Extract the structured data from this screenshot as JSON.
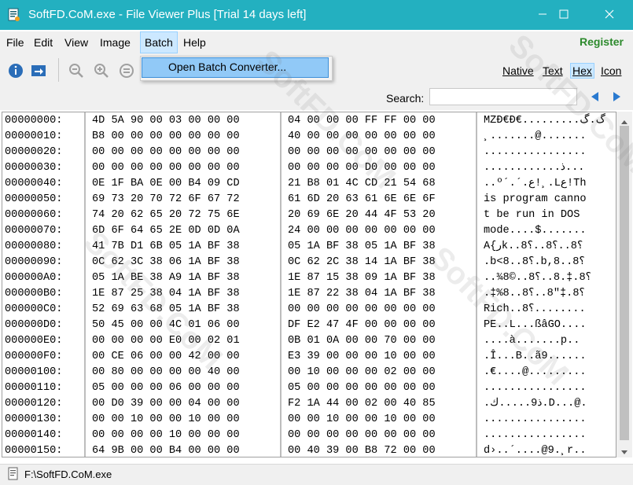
{
  "window": {
    "title": "SoftFD.CoM.exe - File Viewer Plus [Trial 14 days left]"
  },
  "menu": {
    "items": [
      "File",
      "Edit",
      "View",
      "Image",
      "Batch",
      "Help"
    ],
    "register": "Register"
  },
  "batch_menu": {
    "items": [
      "Open Batch Converter..."
    ]
  },
  "viewmodes": [
    "Native",
    "Text",
    "Hex",
    "Icon"
  ],
  "search": {
    "label": "Search:",
    "value": ""
  },
  "hex": {
    "rows": [
      {
        "addr": "00000000:",
        "h1": "4D 5A 90 00 03 00 00 00",
        "h2": "04 00 00 00 FF FF 00 00",
        "ascii": "MZÐ€Ð€.........گ.گ"
      },
      {
        "addr": "00000010:",
        "h1": "B8 00 00 00 00 00 00 00",
        "h2": "40 00 00 00 00 00 00 00",
        "ascii": "¸.......@......."
      },
      {
        "addr": "00000020:",
        "h1": "00 00 00 00 00 00 00 00",
        "h2": "00 00 00 00 00 00 00 00",
        "ascii": "................"
      },
      {
        "addr": "00000030:",
        "h1": "00 00 00 00 00 00 00 00",
        "h2": "00 00 00 00 D0 00 00 00",
        "ascii": "............ذ..."
      },
      {
        "addr": "00000040:",
        "h1": "0E 1F BA 0E 00 B4 09 CD",
        "h2": "21 B8 01 4C CD 21 54 68",
        "ascii": "..º´.´.ع!¸.Lع!Th"
      },
      {
        "addr": "00000050:",
        "h1": "69 73 20 70 72 6F 67 72",
        "h2": "61 6D 20 63 61 6E 6E 6F",
        "ascii": "is program canno"
      },
      {
        "addr": "00000060:",
        "h1": "74 20 62 65 20 72 75 6E",
        "h2": "20 69 6E 20 44 4F 53 20",
        "ascii": "t be run in DOS "
      },
      {
        "addr": "00000070:",
        "h1": "6D 6F 64 65 2E 0D 0D 0A",
        "h2": "24 00 00 00 00 00 00 00",
        "ascii": "mode....$......."
      },
      {
        "addr": "00000080:",
        "h1": "41 7B D1 6B 05 1A BF 38",
        "h2": "05 1A BF 38 05 1A BF 38",
        "ascii": "A{رk..؟8..؟8..؟8"
      },
      {
        "addr": "00000090:",
        "h1": "0C 62 3C 38 06 1A BF 38",
        "h2": "0C 62 2C 38 14 1A BF 38",
        "ascii": ".b<8..؟8.b,8..؟8"
      },
      {
        "addr": "000000A0:",
        "h1": "05 1A BE 38 A9 1A BF 38",
        "h2": "1E 87 15 38 09 1A BF 38",
        "ascii": "..¾8©..؟8.‡.8..؟8"
      },
      {
        "addr": "000000B0:",
        "h1": "1E 87 25 38 04 1A BF 38",
        "h2": "1E 87 22 38 04 1A BF 38",
        "ascii": ".‡%8..؟8.‡\"8..؟8"
      },
      {
        "addr": "000000C0:",
        "h1": "52 69 63 68 05 1A BF 38",
        "h2": "00 00 00 00 00 00 00 00",
        "ascii": "Rich..؟8........"
      },
      {
        "addr": "000000D0:",
        "h1": "50 45 00 00 4C 01 06 00",
        "h2": "DF E2 47 4F 00 00 00 00",
        "ascii": "PE..L...ßâGO...."
      },
      {
        "addr": "000000E0:",
        "h1": "00 00 00 00 E0 00 02 01",
        "h2": "0B 01 0A 00 00 70 00 00",
        "ascii": "....à.......p.."
      },
      {
        "addr": "000000F0:",
        "h1": "00 CE 06 00 00 42 00 00",
        "h2": "E3 39 00 00 00 10 00 00",
        "ascii": ".Î...B..ã9......"
      },
      {
        "addr": "00000100:",
        "h1": "00 80 00 00 00 00 40 00",
        "h2": "00 10 00 00 00 02 00 00",
        "ascii": ".€....@........."
      },
      {
        "addr": "00000110:",
        "h1": "05 00 00 00 06 00 00 00",
        "h2": "05 00 00 00 00 00 00 00",
        "ascii": "................"
      },
      {
        "addr": "00000120:",
        "h1": "00 D0 39 00 00 04 00 00",
        "h2": "F2 1A 44 00 02 00 40 85",
        "ascii": ".ذ9.....ك.D...@."
      },
      {
        "addr": "00000130:",
        "h1": "00 00 10 00 00 10 00 00",
        "h2": "00 00 10 00 00 10 00 00",
        "ascii": "................"
      },
      {
        "addr": "00000140:",
        "h1": "00 00 00 00 10 00 00 00",
        "h2": "00 00 00 00 00 00 00 00",
        "ascii": "................"
      },
      {
        "addr": "00000150:",
        "h1": "64 9B 00 00 B4 00 00 00",
        "h2": "00 40 39 00 B8 72 00 00",
        "ascii": "d›..´....@9.¸r.."
      }
    ]
  },
  "status": {
    "path": "F:\\SoftFD.CoM.exe"
  },
  "watermark": "SoftFD.CoM"
}
